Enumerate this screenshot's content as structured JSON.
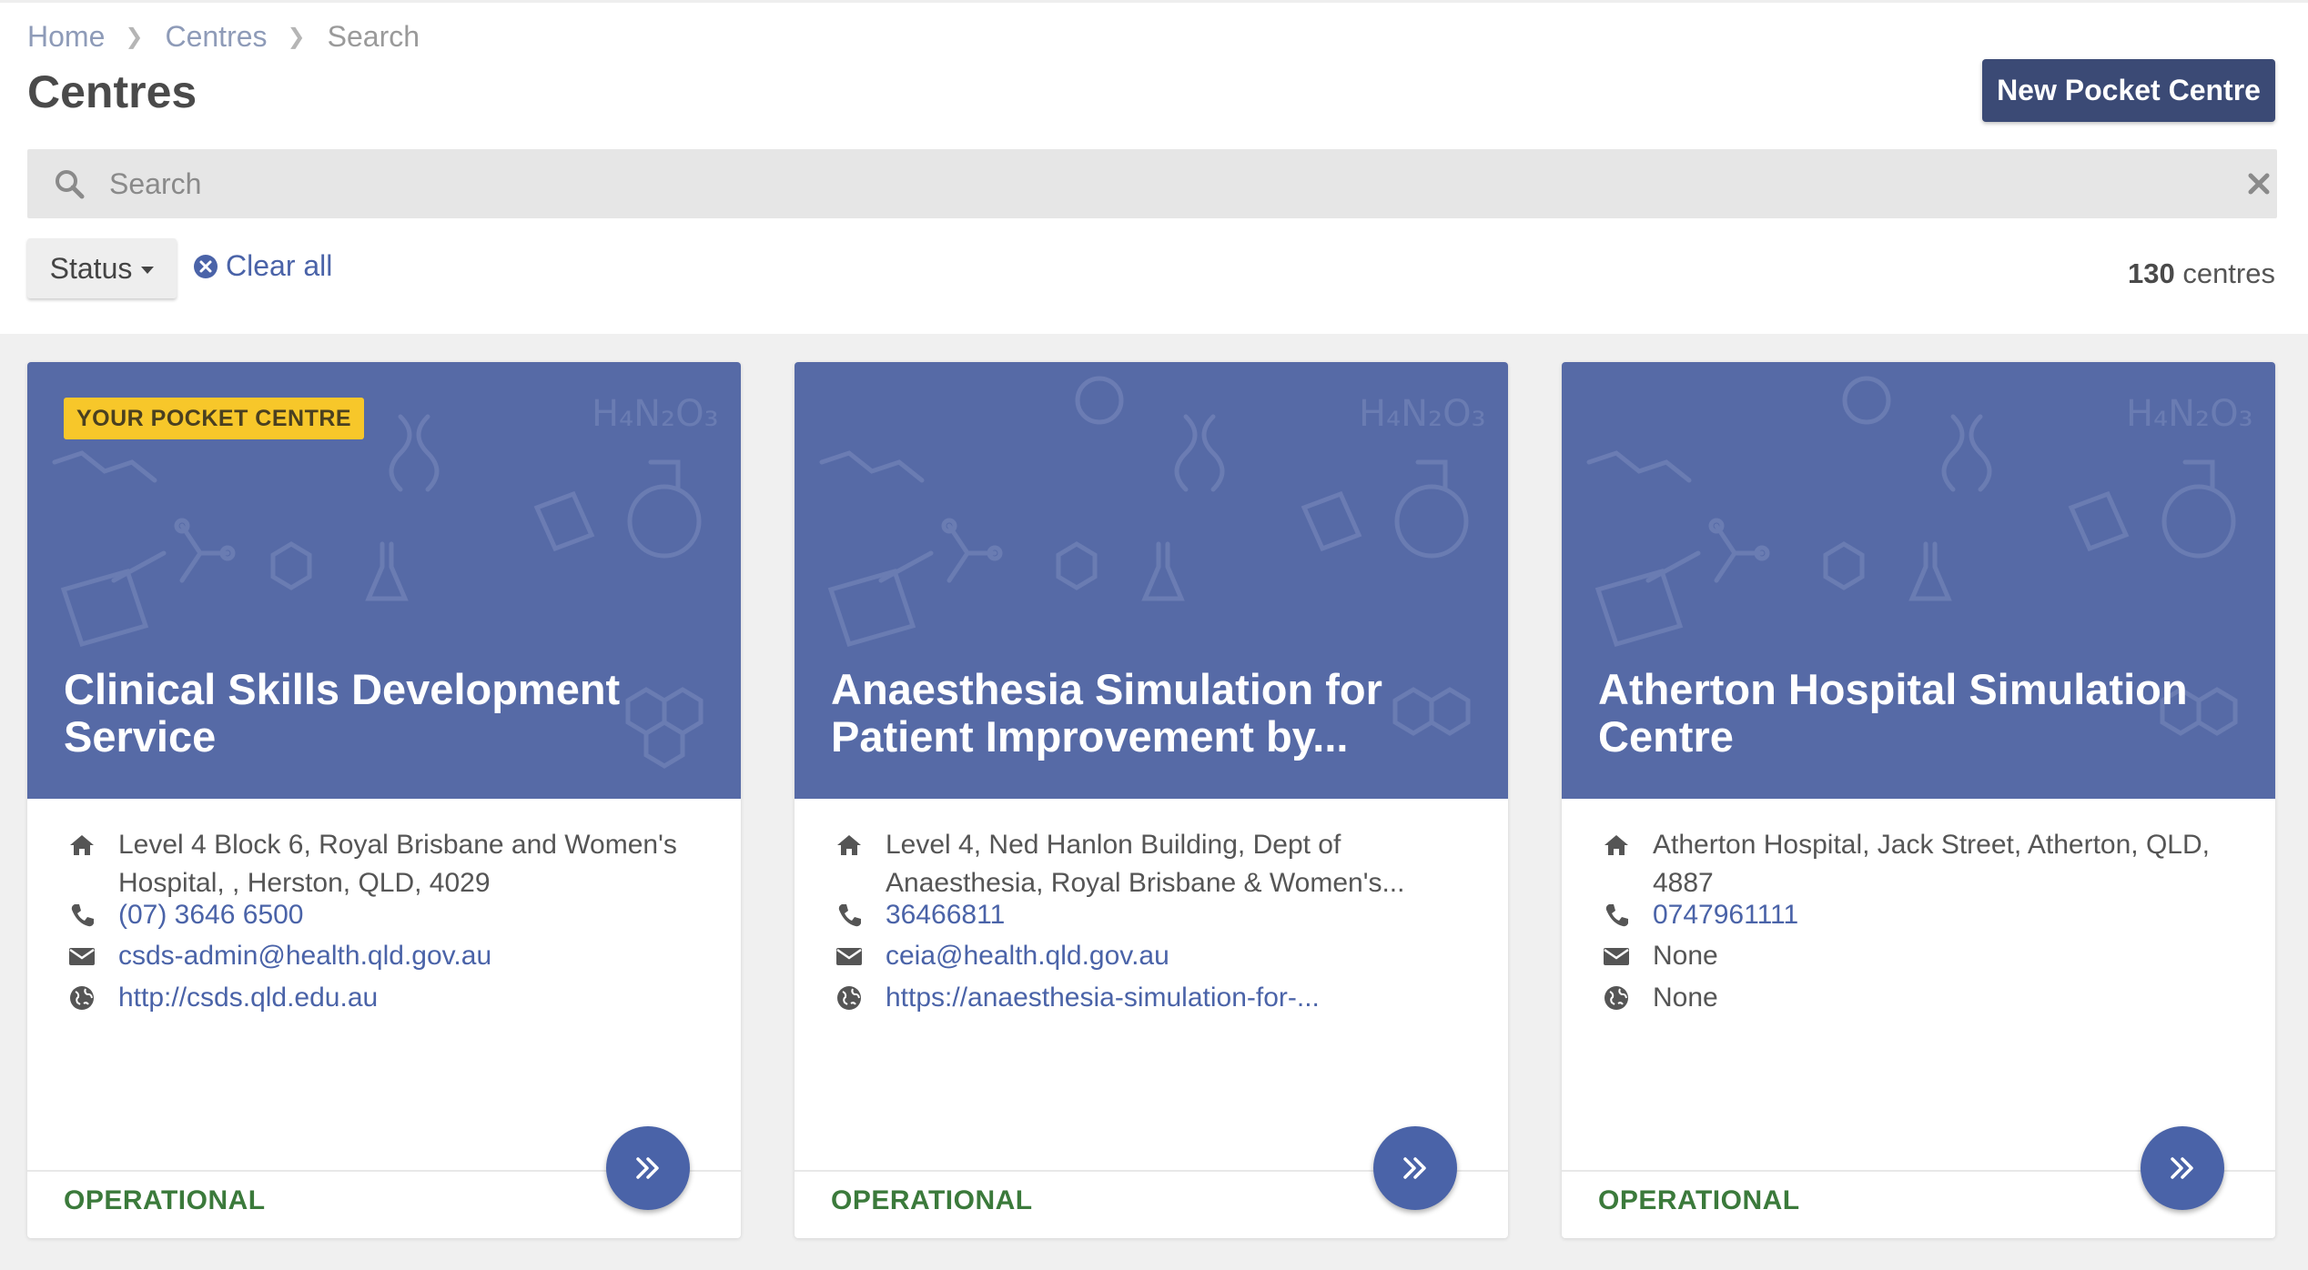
{
  "breadcrumb": {
    "items": [
      "Home",
      "Centres",
      "Search"
    ]
  },
  "page": {
    "title": "Centres"
  },
  "actions": {
    "new_centre": "New Pocket Centre"
  },
  "search": {
    "placeholder": "Search",
    "value": ""
  },
  "filters": {
    "status_label": "Status",
    "clear_all": "Clear all"
  },
  "results": {
    "count": "130",
    "unit": "centres"
  },
  "colors": {
    "primary": "#3b4a75",
    "hero": "#566aa6",
    "link": "#4a63a8",
    "badge": "#f7c72a",
    "operational": "#3b7a3b"
  },
  "cards": [
    {
      "badge": "YOUR POCKET CENTRE",
      "title": "Clinical Skills Development Service",
      "address": "Level 4 Block 6, Royal Brisbane and Women's Hospital, , Herston, QLD, 4029",
      "phone": "(07) 3646 6500",
      "email": "csds-admin@health.qld.gov.au",
      "website": "http://csds.qld.edu.au",
      "status": "OPERATIONAL"
    },
    {
      "badge": "",
      "title": "Anaesthesia Simulation for Patient Improvement by...",
      "address": "Level 4, Ned Hanlon Building, Dept of Anaesthesia, Royal Brisbane & Women's...",
      "phone": "36466811",
      "email": "ceia@health.qld.gov.au",
      "website": "https://anaesthesia-simulation-for-...",
      "status": "OPERATIONAL"
    },
    {
      "badge": "",
      "title": "Atherton Hospital Simulation Centre",
      "address": "Atherton Hospital, Jack Street, Atherton, QLD, 4887",
      "phone": "0747961111",
      "email": "None",
      "website": "None",
      "status": "OPERATIONAL"
    }
  ]
}
